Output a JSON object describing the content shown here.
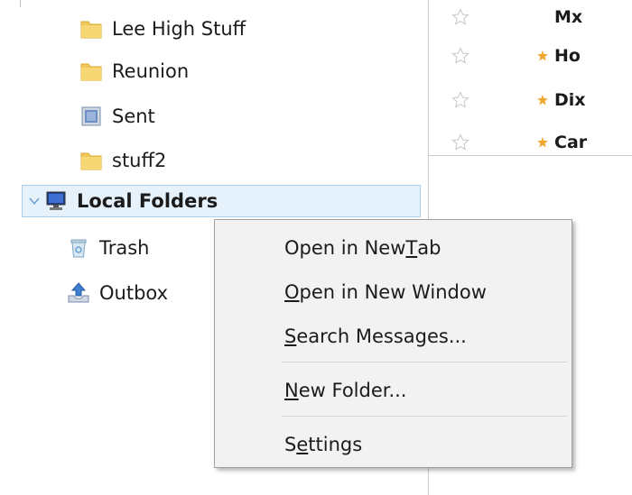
{
  "folder_tree": {
    "items": [
      {
        "label": "Lee High Stuff",
        "icon": "folder-icon"
      },
      {
        "label": "Reunion",
        "icon": "folder-icon"
      },
      {
        "label": "Sent",
        "icon": "sent-folder-icon"
      },
      {
        "label": "stuff2",
        "icon": "folder-icon"
      },
      {
        "label": "Local Folders",
        "icon": "computer-icon",
        "selected": true,
        "expanded": true
      },
      {
        "label": "Trash",
        "icon": "trash-icon"
      },
      {
        "label": "Outbox",
        "icon": "outbox-icon"
      }
    ]
  },
  "message_list": {
    "rows": [
      {
        "subject": "Mx",
        "unread_marker": false
      },
      {
        "subject": "Ho",
        "unread_marker": true
      },
      {
        "subject": "Dix",
        "unread_marker": true
      },
      {
        "subject": "Car",
        "unread_marker": true
      }
    ]
  },
  "context_menu": {
    "items": [
      {
        "pre": "Open in New ",
        "key": "T",
        "post": "ab"
      },
      {
        "pre": "",
        "key": "O",
        "post": "pen in New Window"
      },
      {
        "pre": "",
        "key": "S",
        "post": "earch Messages..."
      },
      {
        "pre": "",
        "key": "N",
        "post": "ew Folder..."
      },
      {
        "pre": "S",
        "key": "e",
        "post": "ttings"
      }
    ]
  },
  "colors": {
    "selection_bg": "#e5f1fb",
    "selection_border": "#a9cfef",
    "folder_yellow": "#f3c85a",
    "unread_star": "#f0a830"
  }
}
